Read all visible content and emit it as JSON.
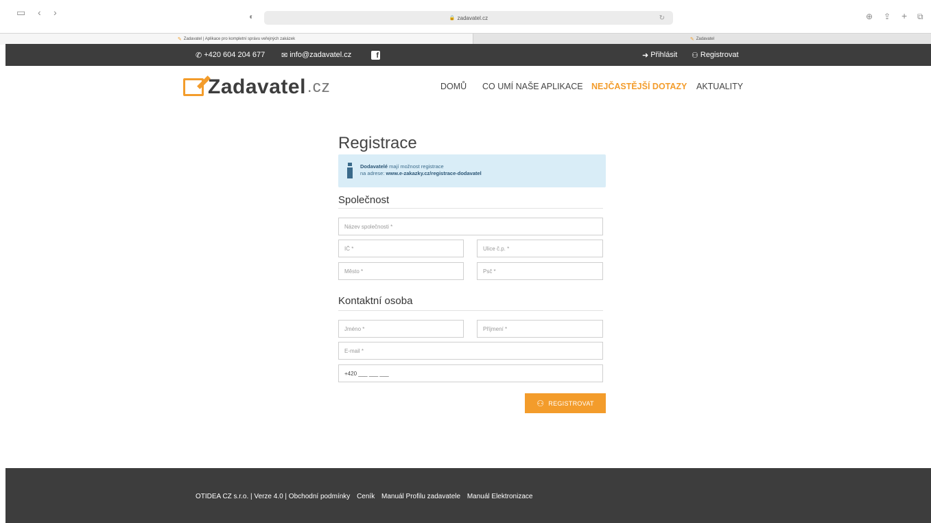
{
  "browser": {
    "url": "zadavatel.cz",
    "tabs": [
      {
        "label": "Zadavatel | Aplikace pro kompletní správu veřejných zakázek"
      },
      {
        "label": "Zadavatel"
      }
    ]
  },
  "topbar": {
    "phone": "+420 604 204 677",
    "email": "info@zadavatel.cz",
    "login": "Přihlásit",
    "register": "Registrovat"
  },
  "header": {
    "logo_name": "Zadavatel",
    "logo_tld": ".cz",
    "nav": [
      "DOMŮ",
      "CO UMÍ NAŠE APLIKACE",
      "NEJČASTĚJŠÍ DOTAZY",
      "AKTUALITY"
    ]
  },
  "form": {
    "title": "Registrace",
    "info_bold": "Dodavatelé",
    "info_text1": " mají možnost registrace",
    "info_text2": "na adrese: ",
    "info_link": "www.e-zakazky.cz/registrace-dodavatel",
    "section_company": "Společnost",
    "company_name": "Název společnosti *",
    "ic": "IČ *",
    "street": "Ulice č.p. *",
    "city": "Město *",
    "zip": "Psč *",
    "section_contact": "Kontaktní osoba",
    "first_name": "Jméno *",
    "last_name": "Příjmení *",
    "email": "E-mail *",
    "phone_value": "+420 ___ ___ ___",
    "submit": "REGISTROVAT"
  },
  "footer": {
    "links": [
      "OTIDEA CZ s.r.o. | Verze 4.0 | Obchodní podmínky",
      "Ceník",
      "Manuál Profilu zadavatele",
      "Manuál Elektronizace"
    ]
  },
  "colors": {
    "accent": "#f39c2b",
    "dark": "#3d3d3d",
    "info_bg": "#d9edf7"
  }
}
